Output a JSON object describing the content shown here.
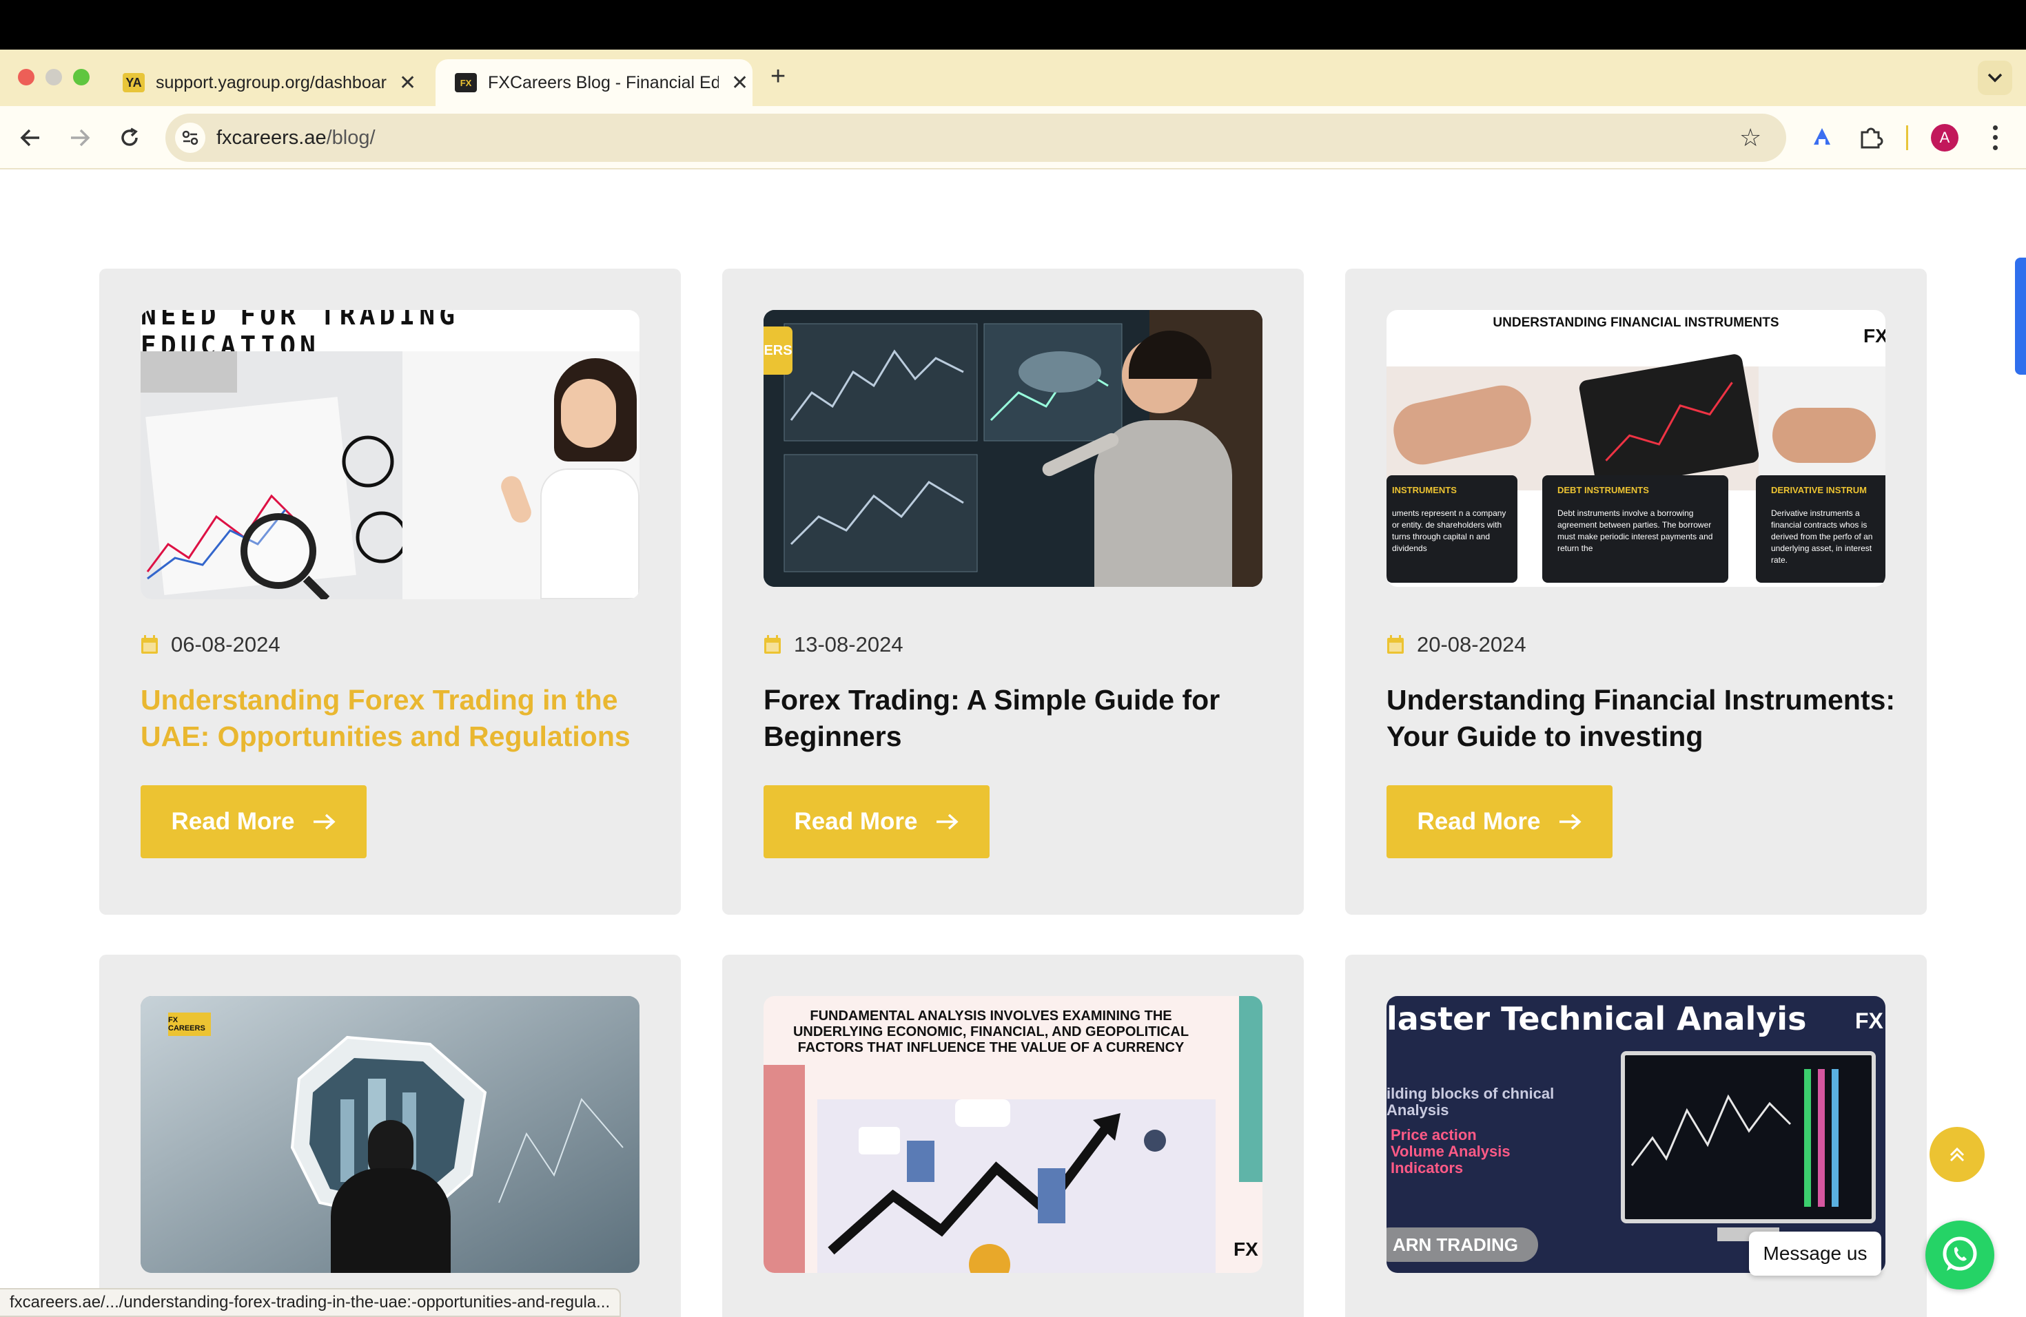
{
  "browser": {
    "tabs": [
      {
        "favicon": "YA",
        "title": "support.yagroup.org/dashboard",
        "active": false
      },
      {
        "favicon": "FX",
        "title": "FXCareers Blog - Financial Education",
        "active": true
      }
    ],
    "url_host": "fxcareers.ae",
    "url_path": "/blog/",
    "profile_initial": "A",
    "status_url": "fxcareers.ae/.../understanding-forex-trading-in-the-uae:-opportunities-and-regula..."
  },
  "colors": {
    "accent": "#ecc332",
    "title_highlight": "#e9b730",
    "card_bg": "#ececec"
  },
  "cards": [
    {
      "date": "06-08-2024",
      "title_line1": "Understanding Forex Trading in the",
      "title_line2": "UAE: Opportunities and Regulations",
      "read_more": "Read More",
      "image_heading": "NEED FOR TRADING EDUCATION"
    },
    {
      "date": "13-08-2024",
      "title_line1": "Forex Trading: A Simple Guide for",
      "title_line2": "Beginners",
      "read_more": "Read More",
      "image_badge": "ERS"
    },
    {
      "date": "20-08-2024",
      "title_line1": "Understanding Financial Instruments:",
      "title_line2": "Your Guide to investing",
      "read_more": "Read More",
      "image_heading": "UNDERSTANDING FINANCIAL INSTRUMENTS",
      "image_logo": "FX",
      "image_boxes": [
        {
          "heading": "INSTRUMENTS",
          "text": "uments represent n a company or entity. de shareholders with turns through capital n and dividends"
        },
        {
          "heading": "DEBT INSTRUMENTS",
          "text": "Debt instruments involve a borrowing agreement between parties. The borrower must make periodic interest payments and return the"
        },
        {
          "heading": "DERIVATIVE INSTRUM",
          "text": "Derivative instruments a financial contracts whos is derived from the perfo of an underlying asset, in interest rate."
        }
      ]
    },
    {
      "image_logo": "FX CAREERS"
    },
    {
      "image_heading": "FUNDAMENTAL ANALYSIS INVOLVES EXAMINING THE UNDERLYING ECONOMIC, FINANCIAL, AND GEOPOLITICAL FACTORS THAT INFLUENCE THE VALUE OF A CURRENCY",
      "image_logo": "FX"
    },
    {
      "image_heading": "laster Technical Analyis",
      "image_logo": "FX",
      "image_sub": "ilding blocks of chnical Analysis",
      "image_items": [
        "Price action",
        "Volume Analysis",
        "Indicators"
      ],
      "image_pill": "ARN TRADING"
    }
  ],
  "widgets": {
    "message_label": "Message us"
  }
}
